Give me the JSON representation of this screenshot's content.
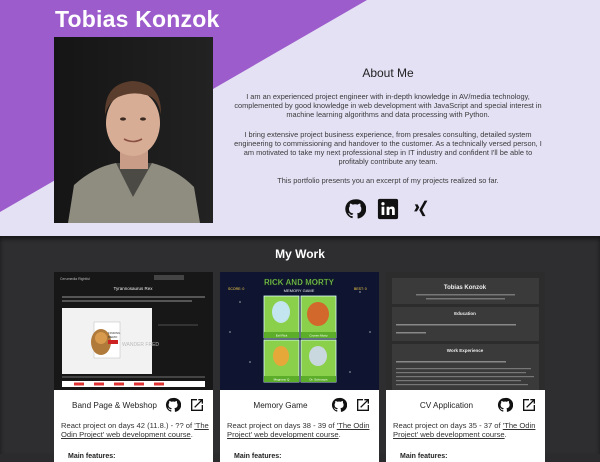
{
  "profile": {
    "name": "Tobias Konzok",
    "portrait_alt": "Portrait of Tobias Konzok"
  },
  "about": {
    "heading": "About Me",
    "paragraphs": [
      "I am an experienced project engineer with in-depth knowledge in AV/media technology, complemented by good knowledge in web development with JavaScript and special interest in machine learning algorithms and data processing with Python.",
      "I bring extensive project business experience, from presales consulting, detailed system engineering to commissioning and handover to the customer. As a technically versed person, I am motivated to take my next professional step in IT industry and confident I'll be able to profitably contribute any team.",
      "This portfolio presents you an excerpt of my projects realized so far."
    ]
  },
  "social": [
    {
      "name": "github-icon"
    },
    {
      "name": "linkedin-icon"
    },
    {
      "name": "xing-icon"
    }
  ],
  "work": {
    "heading": "My Work",
    "projects": [
      {
        "title": "Band Page & Webshop",
        "desc_prefix": "React project on days 42 (11.8.) - ?? of ",
        "link_text": "'The Odin Project' web development course",
        "desc_suffix": ".",
        "shot": {
          "band": "Cerumedia Rightful",
          "heading": "Tyrannosaurus Rex",
          "book_line1": "FINDING",
          "book_line2": "MEMO",
          "book_brand": "WANDER FRED"
        }
      },
      {
        "title": "Memory Game",
        "desc_prefix": "React project on days 38 - 39 of ",
        "link_text": "'The Odin Project' web development course",
        "desc_suffix": ".",
        "shot": {
          "game_title_1": "RICK AND MORTY",
          "game_title_2": "MEMORY GAME",
          "score": "SCORE: 0",
          "best": "BEST: 0",
          "tiles": [
            "Evil Rick",
            "Cronen Morty",
            "Magnano Q",
            "Dr. Schnoops"
          ]
        }
      },
      {
        "title": "CV Application",
        "desc_prefix": "React project on days 35 - 37 of ",
        "link_text": "'The Odin Project' web development course",
        "desc_suffix": ".",
        "shot": {
          "cv_name": "Tobias Konzok",
          "section1": "Education",
          "section2": "Work Experience"
        }
      }
    ],
    "features_label": "Main features:"
  }
}
